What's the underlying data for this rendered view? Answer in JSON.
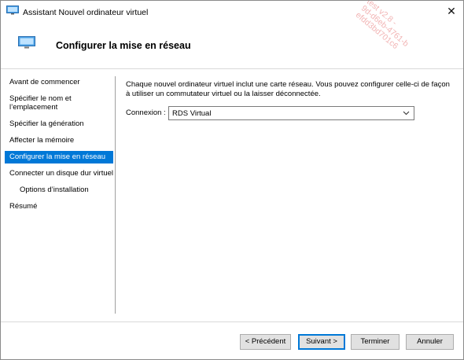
{
  "window": {
    "title": "Assistant Nouvel ordinateur virtuel",
    "close_glyph": "✕"
  },
  "header": {
    "title": "Configurer la mise en réseau"
  },
  "sidebar": {
    "items": [
      {
        "label": "Avant de commencer"
      },
      {
        "label": "Spécifier le nom et l’emplacement"
      },
      {
        "label": "Spécifier la génération"
      },
      {
        "label": "Affecter la mémoire"
      },
      {
        "label": "Configurer la mise en réseau",
        "selected": true
      },
      {
        "label": "Connecter un disque dur virtuel"
      },
      {
        "label": "Options d’installation"
      },
      {
        "label": "Résumé"
      }
    ]
  },
  "main": {
    "description": "Chaque nouvel ordinateur virtuel inclut une carte réseau. Vous pouvez configurer celle-ci de façon à utiliser un commutateur virtuel ou la laisser déconnectée.",
    "connection_label": "Connexion :",
    "connection_value": "RDS Virtual"
  },
  "buttons": {
    "previous": "< Précédent",
    "next": "Suivant >",
    "finish": "Terminer",
    "cancel": "Annuler"
  },
  "watermark": {
    "lines": [
      "test v2.8 - ",
      "9d-d6eb-4761-b",
      "efdd3bd701c6"
    ]
  },
  "colors": {
    "accent": "#0078d7",
    "watermark": "#f2b5b5"
  },
  "icons": {
    "title": "virtual-machine-icon",
    "header": "virtual-machine-icon",
    "close": "close-icon",
    "dropdown": "chevron-down-icon"
  }
}
